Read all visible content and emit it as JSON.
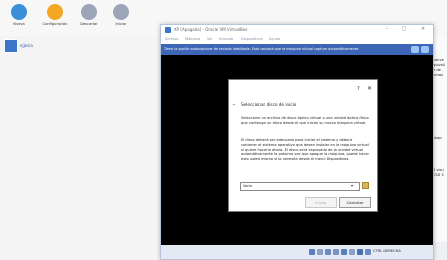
{
  "manager": {
    "toolbar": [
      {
        "label": "Nueva",
        "color": "#3a8fd9"
      },
      {
        "label": "Configuración",
        "color": "#f5a623"
      },
      {
        "label": "Descartar",
        "color": "#9aa6b8"
      },
      {
        "label": "Iniciar",
        "color": "#9aa6b8"
      }
    ],
    "vm": {
      "name": "ejjesia"
    },
    "right_strip": [
      "conve",
      "quivali",
      "e de",
      "umas",
      "shop",
      "4 visu",
      "ESD S"
    ]
  },
  "vm_window": {
    "title": "XP [Apagada] - Oracle VM VirtualBox",
    "controls": {
      "minimize": "–",
      "maximize": "□",
      "close": "✕"
    },
    "menu": [
      "Archivo",
      "Máquina",
      "Ver",
      "Entrada",
      "Dispositivos",
      "Ayuda"
    ],
    "notification": "Tiene la opción autocapturar de teclado habilitada. Esto causará que la máquina virtual capture automáticamente",
    "status": {
      "host_key": "CTRL DERECHA"
    }
  },
  "dialog": {
    "help": "?",
    "close": "✕",
    "back": "←",
    "title": "Seleccionar disco de inicio",
    "paragraph1": "Seleccione un archivo de disco óptico virtual o una unidad óptica física que contenga un disco desde el que iniciar su nueva máquina virtual.",
    "paragraph2": "El disco deberá ser adecuado para iniciar el sistema y deberá contener el sistema operativo que desea instalar en la máquina virtual si quiere hacerlo ahora. El disco será expulsado de la unidad virtual automáticamente la próxima vez que apague la máquina, puede hacer esto usted mismo si lo necesita desde el menú Dispositivos.",
    "select_value": "Vacío",
    "start_label": "Iniciar",
    "cancel_label": "Cancelar"
  }
}
